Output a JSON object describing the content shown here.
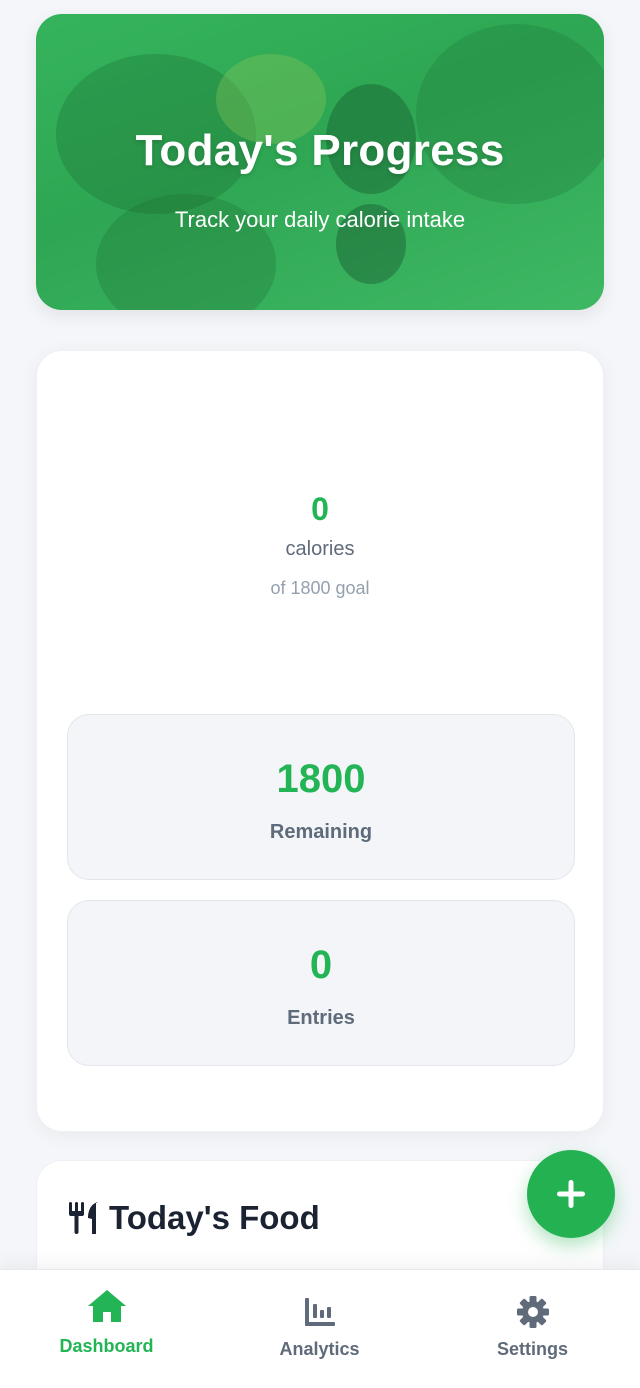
{
  "hero": {
    "title": "Today's Progress",
    "subtitle": "Track your daily calorie intake"
  },
  "progress": {
    "calories": "0",
    "unit": "calories",
    "goal_text": "of 1800 goal",
    "goal": 1800
  },
  "stats": [
    {
      "value": "1800",
      "label": "Remaining"
    },
    {
      "value": "0",
      "label": "Entries"
    }
  ],
  "food": {
    "title": "Today's Food"
  },
  "fab": {
    "icon": "plus-icon"
  },
  "nav": {
    "items": [
      {
        "label": "Dashboard",
        "icon": "home-icon",
        "active": true
      },
      {
        "label": "Analytics",
        "icon": "chart-icon",
        "active": false
      },
      {
        "label": "Settings",
        "icon": "gear-icon",
        "active": false
      }
    ]
  },
  "colors": {
    "accent": "#22b455",
    "nav_inactive": "#5f6b7a",
    "text_dark": "#1b2333"
  }
}
